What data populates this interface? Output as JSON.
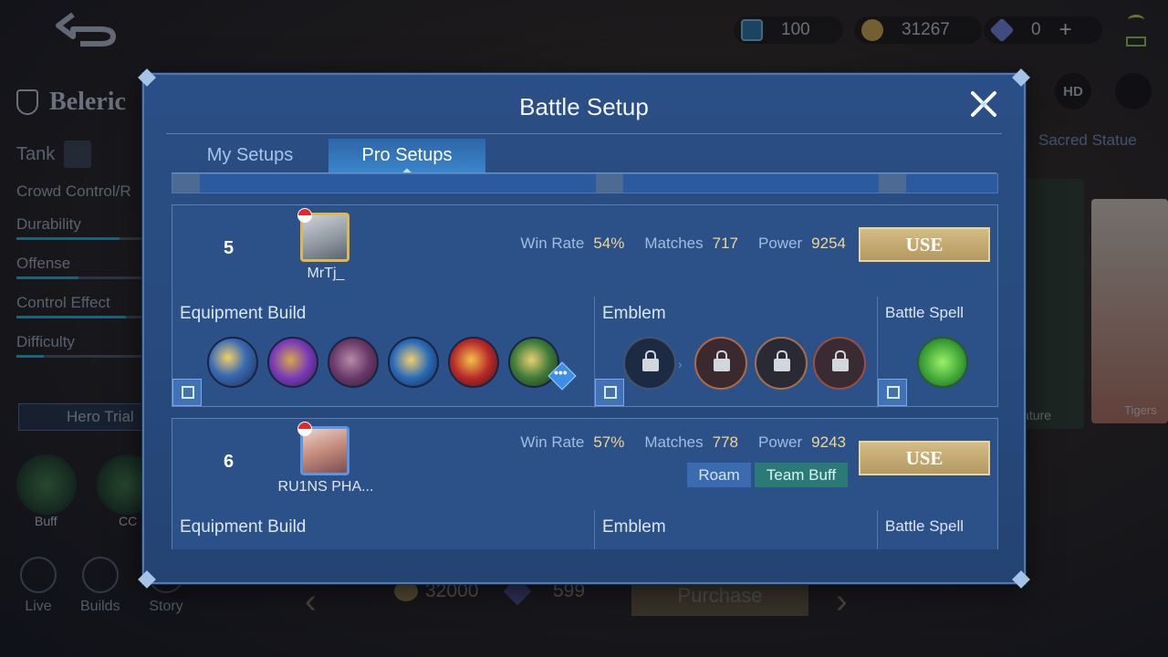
{
  "background": {
    "currencies": [
      {
        "name": "m-coin-icon",
        "value": "100"
      },
      {
        "name": "gold-coin-icon",
        "value": "31267"
      },
      {
        "name": "diamond-icon",
        "value": "0"
      }
    ],
    "hero_name": "Beleric",
    "role": "Tank",
    "stats": [
      "Crowd Control/R",
      "Durability",
      "Offense",
      "Control Effect",
      "Difficulty"
    ],
    "stat_levels": [
      0.9,
      0.75,
      0.45,
      0.8,
      0.2
    ],
    "hero_trial": "Hero Trial",
    "skills": [
      "Buff",
      "CC"
    ],
    "nav": [
      "Live",
      "Builds",
      "Story"
    ],
    "hd": "HD",
    "sacred_statue": "Sacred Statue",
    "nature_label": "Nature",
    "tigers_label": "Tigers",
    "price_gold": "32000",
    "price_diamond": "599",
    "purchase": "Purchase"
  },
  "modal": {
    "title": "Battle Setup",
    "tabs": [
      {
        "label": "My Setups",
        "active": false
      },
      {
        "label": "Pro Setups",
        "active": true
      }
    ],
    "setups": [
      {
        "rank": "5",
        "player": "MrTj_",
        "win_rate_label": "Win Rate",
        "win_rate": "54%",
        "matches_label": "Matches",
        "matches": "717",
        "power_label": "Power",
        "power": "9254",
        "use_label": "USE",
        "tags": [],
        "equipment_title": "Equipment Build",
        "emblem_title": "Emblem",
        "spell_title": "Battle Spell",
        "items": [
          "boots-item-icon",
          "armor-item-icon",
          "spiked-gauntlet-item-icon",
          "winged-helm-item-icon",
          "fire-shield-item-icon",
          "golden-helm-item-icon"
        ],
        "emblems": [
          "emblem-base-icon",
          "emblem-tier1-icon",
          "emblem-tier2-icon",
          "emblem-tier3-icon"
        ],
        "spell": "vengeance-spell-icon"
      },
      {
        "rank": "6",
        "player": "RU1NS PHA...",
        "win_rate_label": "Win Rate",
        "win_rate": "57%",
        "matches_label": "Matches",
        "matches": "778",
        "power_label": "Power",
        "power": "9243",
        "use_label": "USE",
        "tags": [
          "Roam",
          "Team Buff"
        ],
        "equipment_title": "Equipment Build",
        "emblem_title": "Emblem",
        "spell_title": "Battle Spell"
      }
    ]
  },
  "colors": {
    "modal_bg": "#2a4f86",
    "gold_text": "#f1d693",
    "use_button": "#c9ae72",
    "tag_roam": "#3a6ab0",
    "tag_team_buff": "#2b7a78"
  }
}
